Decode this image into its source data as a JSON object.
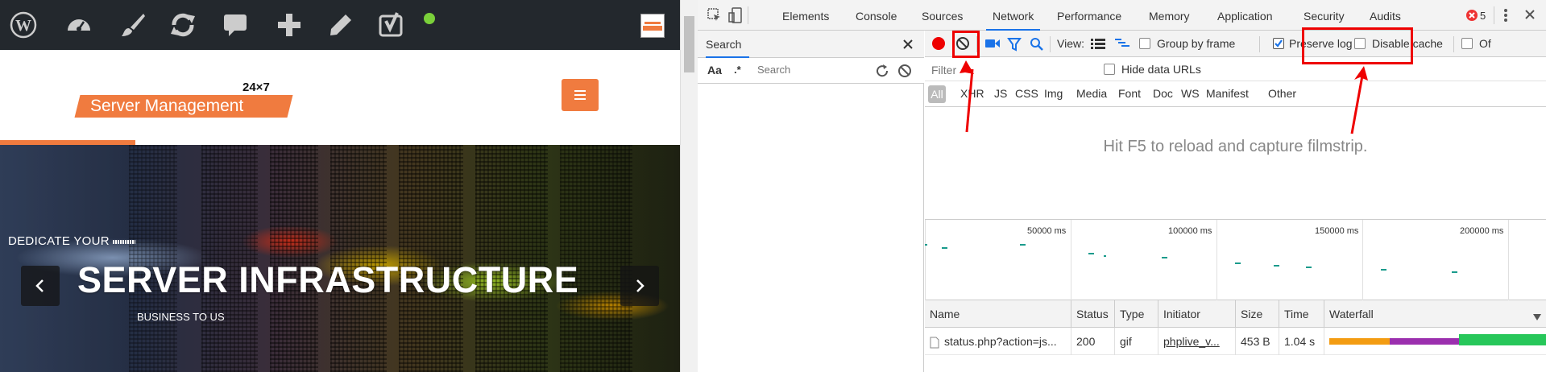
{
  "site": {
    "logo_top": "24×7",
    "logo_text": "Server Management",
    "hero": {
      "kicker": "DEDICATE YOUR",
      "title": "SERVER INFRASTRUCTURE",
      "subtitle": "BUSINESS TO US"
    },
    "wp_bar_icons": [
      "wordpress-icon",
      "dashboard-icon",
      "customize-brush-icon",
      "updates-icon",
      "comments-icon",
      "new-plus-icon",
      "edit-pencil-icon",
      "yoast-icon",
      "status-dot-icon"
    ],
    "accent": "#f07b3f"
  },
  "devtools": {
    "tabs": [
      "Elements",
      "Console",
      "Sources",
      "Network",
      "Performance",
      "Memory",
      "Application",
      "Security",
      "Audits"
    ],
    "selected_tab": "Network",
    "error_count": "5",
    "search": {
      "tab_label": "Search",
      "aa": "Aa",
      "regex": ".*",
      "placeholder": "Search"
    },
    "toolbar": {
      "view_label": "View:",
      "group_by_frame": "Group by frame",
      "preserve_log": "Preserve log",
      "preserve_log_checked": true,
      "disable_cache": "Disable cache",
      "offline": "Of"
    },
    "filter": {
      "placeholder": "Filter",
      "hide_data_urls": "Hide data URLs"
    },
    "types": [
      "All",
      "XHR",
      "JS",
      "CSS",
      "Img",
      "Media",
      "Font",
      "Doc",
      "WS",
      "Manifest",
      "Other"
    ],
    "filmstrip_msg": "Hit F5 to reload and capture filmstrip.",
    "overview_ticks": [
      "50000 ms",
      "100000 ms",
      "150000 ms",
      "200000 ms"
    ],
    "columns": [
      "Name",
      "Status",
      "Type",
      "Initiator",
      "Size",
      "Time",
      "Waterfall"
    ],
    "rows": [
      {
        "name": "status.php?action=js...",
        "status": "200",
        "type": "gif",
        "initiator": "phplive_v...",
        "size": "453 B",
        "time": "1.04 s"
      }
    ],
    "colors": {
      "record": "#e00",
      "accent": "#1a73e8",
      "highlight": "#e00"
    }
  }
}
